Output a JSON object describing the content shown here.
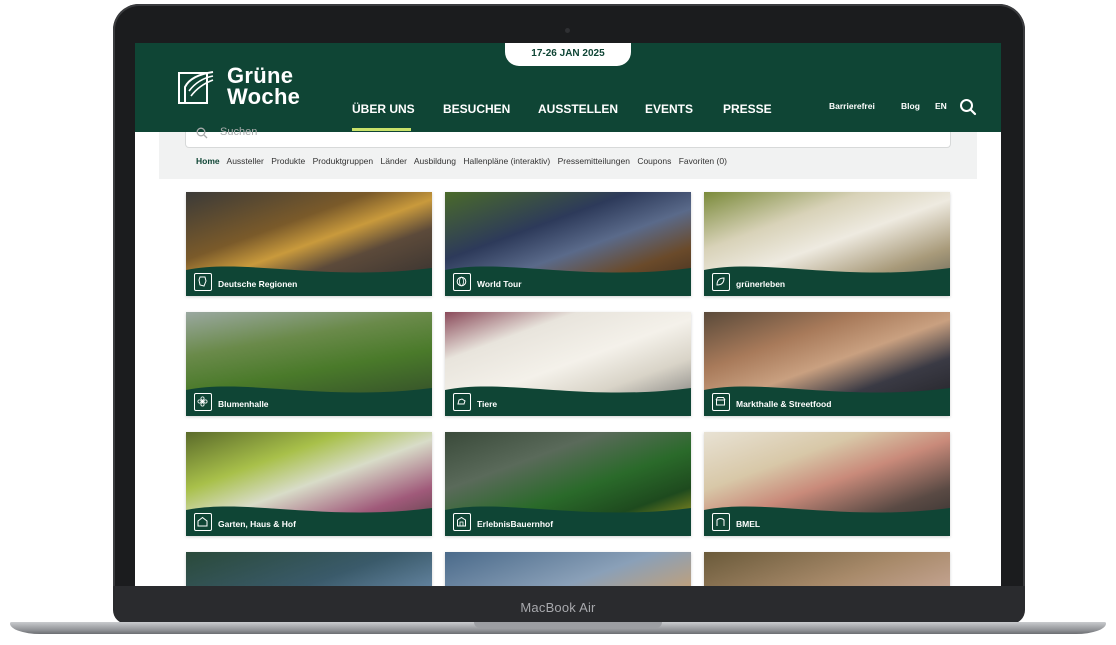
{
  "device": {
    "model_label": "MacBook Air"
  },
  "header": {
    "date_range": "17-26 JAN 2025",
    "logo_line1": "Grüne",
    "logo_line2": "Woche",
    "nav": [
      {
        "label": "ÜBER UNS",
        "active": true
      },
      {
        "label": "BESUCHEN"
      },
      {
        "label": "AUSSTELLEN"
      },
      {
        "label": "EVENTS"
      },
      {
        "label": "PRESSE"
      }
    ],
    "utility": {
      "accessibility": "Barrierefrei",
      "blog": "Blog",
      "language": "EN"
    },
    "icons": {
      "search": "search-icon",
      "logo": "leaf-logo-icon"
    }
  },
  "search": {
    "placeholder": "Suchen"
  },
  "filters": [
    "Home",
    "Aussteller",
    "Produkte",
    "Produktgruppen",
    "Länder",
    "Ausbildung",
    "Hallenpläne (interaktiv)",
    "Pressemitteilungen",
    "Coupons",
    "Favoriten (0)"
  ],
  "tiles": [
    {
      "label": "Deutsche Regionen",
      "icon": "region-icon"
    },
    {
      "label": "World Tour",
      "icon": "globe-icon"
    },
    {
      "label": "grünerleben",
      "icon": "leaf-hand-icon"
    },
    {
      "label": "Blumenhalle",
      "icon": "flower-icon"
    },
    {
      "label": "Tiere",
      "icon": "animal-icon"
    },
    {
      "label": "Markthalle & Streetfood",
      "icon": "market-icon"
    },
    {
      "label": "Garten, Haus & Hof",
      "icon": "garden-icon"
    },
    {
      "label": "ErlebnisBauernhof",
      "icon": "barn-icon"
    },
    {
      "label": "BMEL",
      "icon": "bmel-icon"
    }
  ],
  "colors": {
    "brand_green": "#0f4535",
    "accent_lime": "#c9e26a"
  }
}
